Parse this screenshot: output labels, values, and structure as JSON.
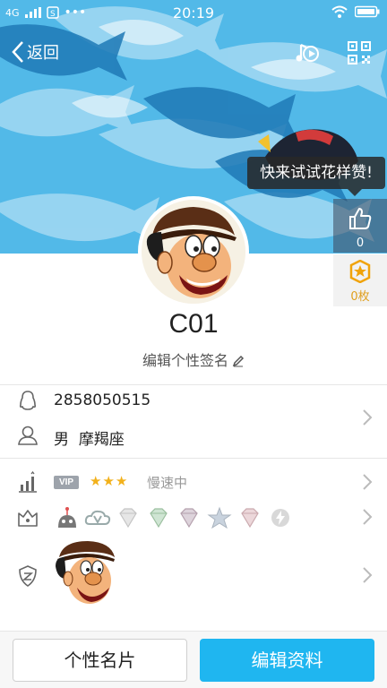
{
  "status_bar": {
    "network": "4G",
    "time": "20:19"
  },
  "navbar": {
    "back_label": "返回",
    "icons": [
      "music-note-icon",
      "qr-code-icon"
    ]
  },
  "tip": {
    "text": "快来试试花样赞!"
  },
  "like": {
    "count": "0"
  },
  "coins": {
    "label": "0枚"
  },
  "profile": {
    "nickname": "C01",
    "signature_placeholder": "编辑个性签名"
  },
  "info": {
    "qq_number": "2858050515",
    "gender": "男",
    "zodiac": "摩羯座"
  },
  "vip": {
    "tag": "VIP",
    "stars": [
      "★",
      "★",
      "★"
    ],
    "speed_text": "慢速中"
  },
  "badges": [
    "robot-badge-icon",
    "cloud-v-badge-icon",
    "diamond-badge-icon",
    "diamond-green-badge-icon",
    "diamond-purple-badge-icon",
    "star-badge-icon",
    "diamond-pink-badge-icon",
    "bolt-badge-icon"
  ],
  "footer": {
    "card_button": "个性名片",
    "edit_button": "编辑资料"
  },
  "colors": {
    "banner_blue": "#4db7e6",
    "accent": "#1fb6f0",
    "gold": "#f2b11b"
  }
}
